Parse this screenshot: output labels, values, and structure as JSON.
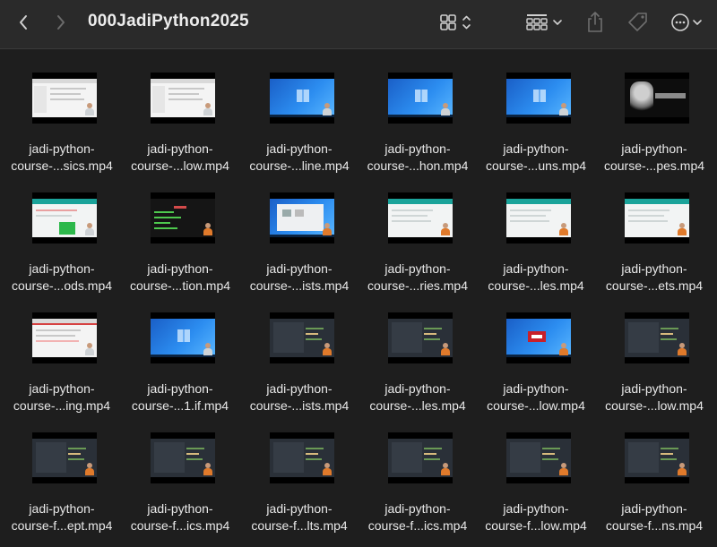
{
  "window": {
    "title": "000JadiPython2025"
  },
  "icons": {
    "back": "chevron-left-icon",
    "forward": "chevron-right-icon",
    "view": "grid-view-icon",
    "group": "group-by-icon",
    "share": "share-icon",
    "tag": "tag-icon",
    "more": "more-icon"
  },
  "colors": {
    "background": "#1e1e1e",
    "toolbar": "#2a2a2a",
    "text": "#e8e8e8"
  },
  "files": [
    {
      "line1": "jadi-python-",
      "line2": "course-...sics.mp4",
      "thumb": "browser"
    },
    {
      "line1": "jadi-python-",
      "line2": "course-...low.mp4",
      "thumb": "browser"
    },
    {
      "line1": "jadi-python-",
      "line2": "course-...line.mp4",
      "thumb": "win"
    },
    {
      "line1": "jadi-python-",
      "line2": "course-...hon.mp4",
      "thumb": "win"
    },
    {
      "line1": "jadi-python-",
      "line2": "course-...uns.mp4",
      "thumb": "win"
    },
    {
      "line1": "jadi-python-",
      "line2": "course-...pes.mp4",
      "thumb": "film"
    },
    {
      "line1": "jadi-python-",
      "line2": "course-...ods.mp4",
      "thumb": "teal-green"
    },
    {
      "line1": "jadi-python-",
      "line2": "course-...tion.mp4",
      "thumb": "term"
    },
    {
      "line1": "jadi-python-",
      "line2": "course-...ists.mp4",
      "thumb": "win-browser"
    },
    {
      "line1": "jadi-python-",
      "line2": "course-...ries.mp4",
      "thumb": "teal"
    },
    {
      "line1": "jadi-python-",
      "line2": "course-...les.mp4",
      "thumb": "teal"
    },
    {
      "line1": "jadi-python-",
      "line2": "course-...ets.mp4",
      "thumb": "teal"
    },
    {
      "line1": "jadi-python-",
      "line2": "course-...ing.mp4",
      "thumb": "browser-red"
    },
    {
      "line1": "jadi-python-",
      "line2": "course-...1.if.mp4",
      "thumb": "win"
    },
    {
      "line1": "jadi-python-",
      "line2": "course-...ists.mp4",
      "thumb": "dark"
    },
    {
      "line1": "jadi-python-",
      "line2": "course-...les.mp4",
      "thumb": "dark"
    },
    {
      "line1": "jadi-python-",
      "line2": "course-...low.mp4",
      "thumb": "win-red"
    },
    {
      "line1": "jadi-python-",
      "line2": "course-...low.mp4",
      "thumb": "dark"
    },
    {
      "line1": "jadi-python-",
      "line2": "course-f...ept.mp4",
      "thumb": "dark"
    },
    {
      "line1": "jadi-python-",
      "line2": "course-f...ics.mp4",
      "thumb": "dark"
    },
    {
      "line1": "jadi-python-",
      "line2": "course-f...lts.mp4",
      "thumb": "dark"
    },
    {
      "line1": "jadi-python-",
      "line2": "course-f...ics.mp4",
      "thumb": "dark"
    },
    {
      "line1": "jadi-python-",
      "line2": "course-f...low.mp4",
      "thumb": "dark"
    },
    {
      "line1": "jadi-python-",
      "line2": "course-f...ns.mp4",
      "thumb": "dark"
    }
  ]
}
